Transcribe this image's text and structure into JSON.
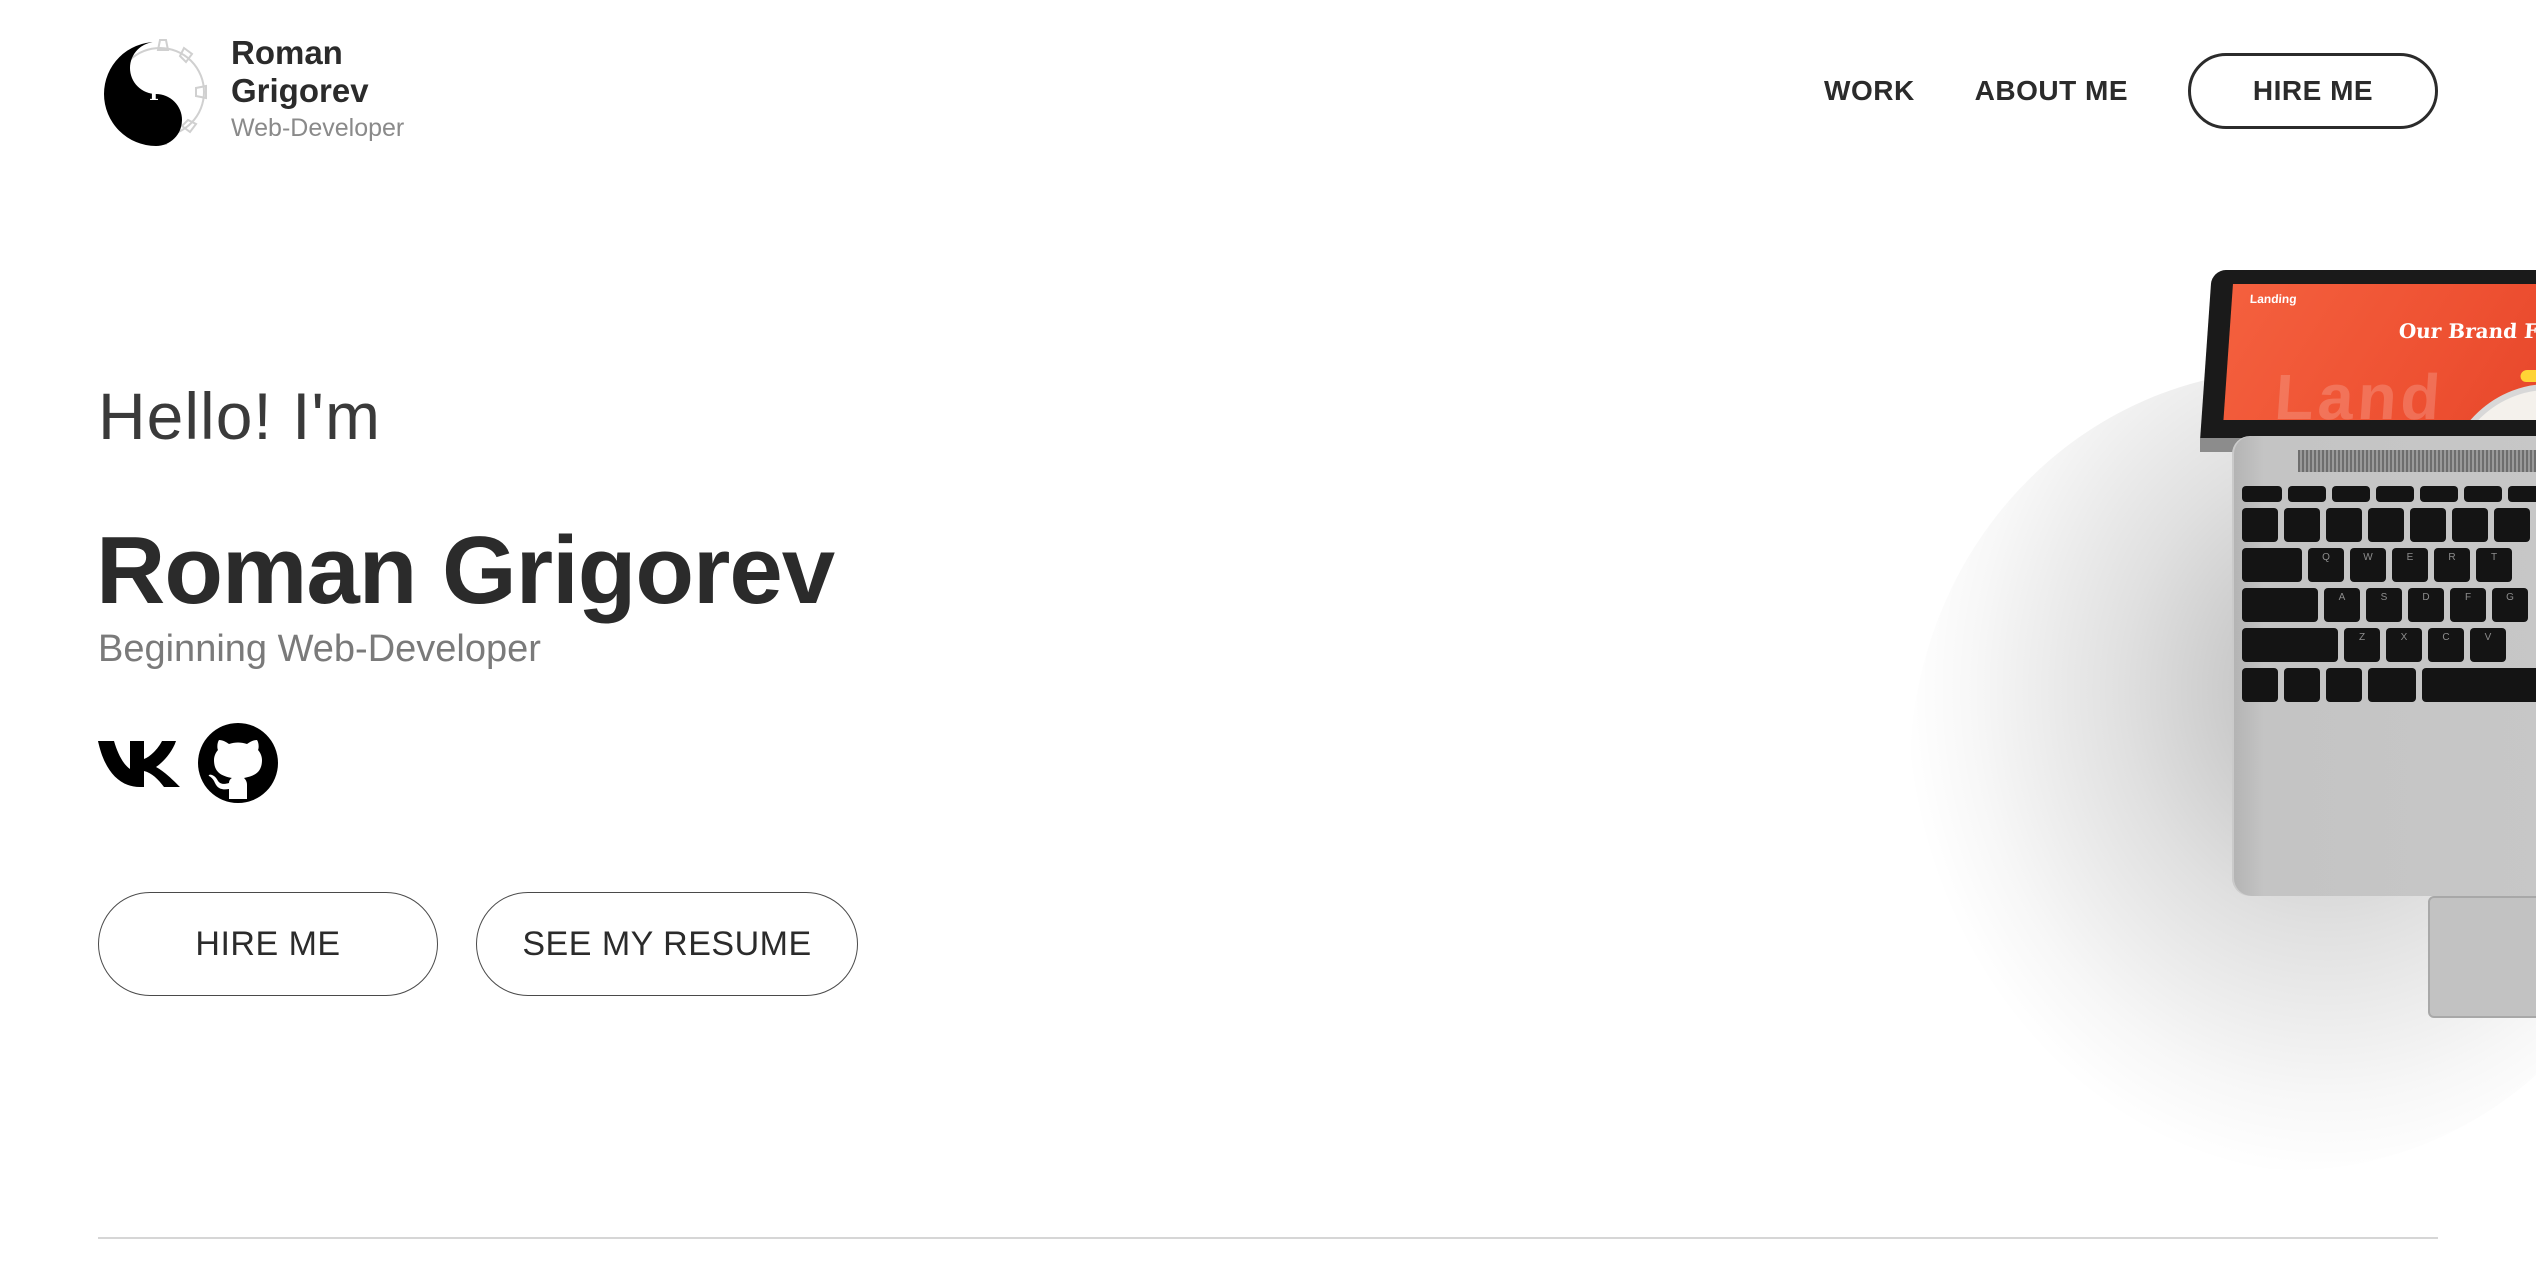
{
  "header": {
    "brand_name": "Roman Grigorev",
    "brand_role": "Web-Developer",
    "logo_initials": "Г"
  },
  "nav": {
    "work": "WORK",
    "about": "ABOUT ME",
    "hire": "HIRE ME"
  },
  "hero": {
    "greeting": "Hello! I'm",
    "name": "Roman Grigorev",
    "role": "Beginning Web-Developer",
    "hire_button": "HIRE ME",
    "resume_button": "SEE MY RESUME"
  },
  "socials": [
    {
      "icon": "vk-icon"
    },
    {
      "icon": "github-icon"
    }
  ],
  "laptop_screen": {
    "logo": "Landing",
    "headline": "Our Brand Firm",
    "bg_word": "Land"
  },
  "colors": {
    "text": "#2b2b2b",
    "muted": "#7a7a7a",
    "accent_screen": "#f4603e",
    "divider": "#d6d6d6"
  }
}
